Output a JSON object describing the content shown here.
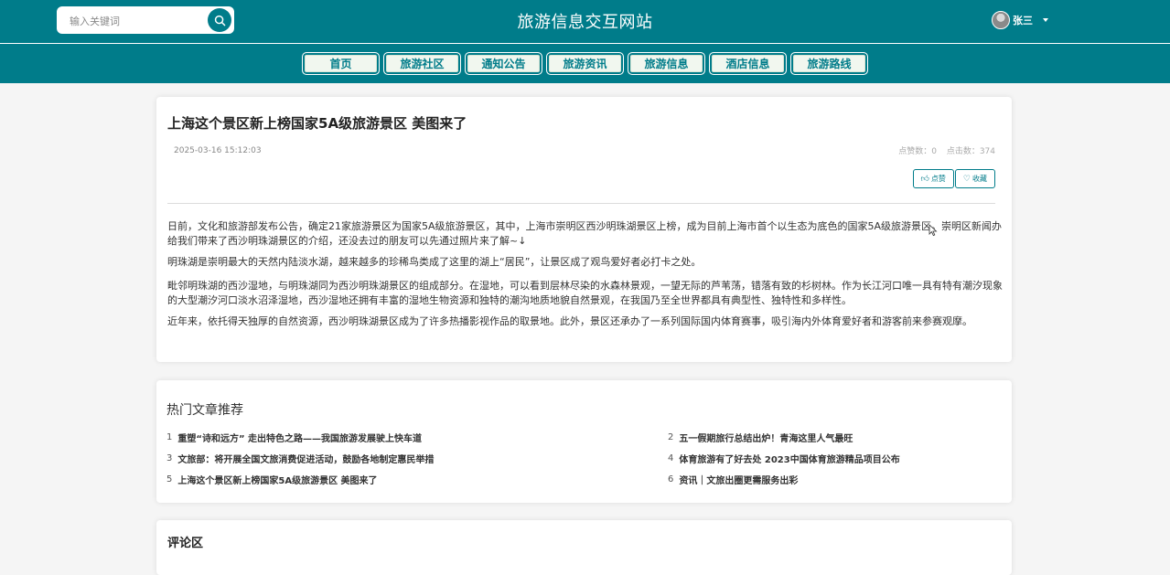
{
  "header": {
    "search_placeholder": "输入关键词",
    "site_title": "旅游信息交互网站",
    "user_name": "张三"
  },
  "nav": {
    "items": [
      "首页",
      "旅游社区",
      "通知公告",
      "旅游资讯",
      "旅游信息",
      "酒店信息",
      "旅游路线"
    ]
  },
  "article": {
    "title": "上海这个景区新上榜国家5A级旅游景区 美图来了",
    "date": "2025-03-16 15:12:03",
    "likes_label": "点赞数：0",
    "clicks_label": "点击数：374",
    "like_button": "点赞",
    "favorite_button": "收藏",
    "paragraphs": [
      "日前，文化和旅游部发布公告，确定21家旅游景区为国家5A级旅游景区，其中，上海市崇明区西沙明珠湖景区上榜，成为目前上海市首个以生态为底色的国家5A级旅游景区。崇明区新闻办给我们带来了西沙明珠湖景区的介绍，还没去过的朋友可以先通过照片来了解~↓",
      "明珠湖是崇明最大的天然内陆淡水湖，越来越多的珍稀鸟类成了这里的湖上“居民”，让景区成了观鸟爱好者必打卡之处。",
      "毗邻明珠湖的西沙湿地，与明珠湖同为西沙明珠湖景区的组成部分。在湿地，可以看到层林尽染的水森林景观，一望无际的芦苇荡，错落有致的杉树林。作为长江河口唯一具有特有潮汐现象的大型潮汐河口淡水沼泽湿地，西沙湿地还拥有丰富的湿地生物资源和独特的潮沟地质地貌自然景观，在我国乃至全世界都具有典型性、独特性和多样性。",
      "近年来，依托得天独厚的自然资源，西沙明珠湖景区成为了许多热播影视作品的取景地。此外，景区还承办了一系列国际国内体育赛事，吸引海内外体育爱好者和游客前来参赛观摩。"
    ]
  },
  "hot": {
    "heading": "热门文章推荐",
    "items": [
      {
        "num": "1",
        "title": "重塑“诗和远方” 走出特色之路——我国旅游发展驶上快车道"
      },
      {
        "num": "2",
        "title": "五一假期旅行总结出炉！青海这里人气最旺"
      },
      {
        "num": "3",
        "title": "文旅部：将开展全国文旅消费促进活动，鼓励各地制定惠民举措"
      },
      {
        "num": "4",
        "title": "体育旅游有了好去处 2023中国体育旅游精品项目公布"
      },
      {
        "num": "5",
        "title": "上海这个景区新上榜国家5A级旅游景区 美图来了"
      },
      {
        "num": "6",
        "title": "资讯｜文旅出圈更需服务出彩"
      }
    ]
  },
  "comments": {
    "heading": "评论区"
  },
  "colors": {
    "primary": "#007c8a",
    "nav_button_bg": "#f1f7ef",
    "page_bg": "#f5f5f5"
  }
}
